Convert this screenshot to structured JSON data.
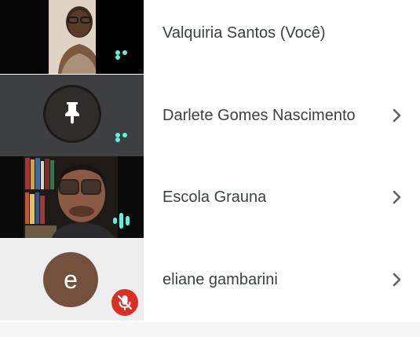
{
  "participants": [
    {
      "name": "Valquiria Santos (Você)",
      "avatar_letter": ""
    },
    {
      "name": "Darlete Gomes Nascimento",
      "avatar_letter": ""
    },
    {
      "name": "Escola Grauna",
      "avatar_letter": ""
    },
    {
      "name": "eliane gambarini",
      "avatar_letter": "e"
    }
  ],
  "colors": {
    "accent_teal": "#5ff0d9",
    "mute_red": "#d93025",
    "avatar_brown": "#74513d"
  },
  "icons": [
    "more-options-icon",
    "pin-icon",
    "audio-level-icon",
    "mic-off-icon",
    "chevron-right-icon"
  ]
}
